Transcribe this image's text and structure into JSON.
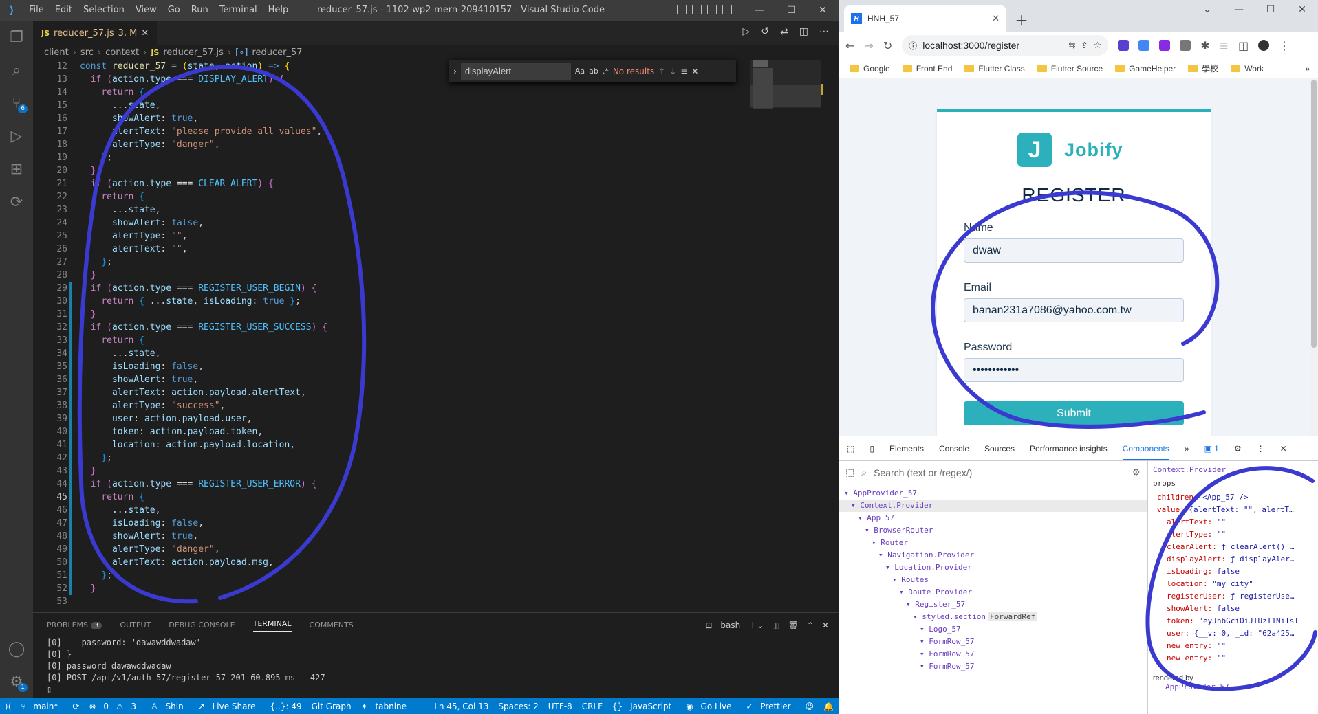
{
  "vscode": {
    "menus": [
      "File",
      "Edit",
      "Selection",
      "View",
      "Go",
      "Run",
      "Terminal",
      "Help"
    ],
    "window_title": "reducer_57.js - 1102-wp2-mern-209410157 - Visual Studio Code",
    "tab": {
      "label": "reducer_57.js",
      "badge": "3, M"
    },
    "breadcrumb": [
      "client",
      "src",
      "context",
      "reducer_57.js",
      "reducer_57"
    ],
    "find": {
      "value": "displayAlert",
      "options": [
        "Aa",
        "ab",
        ".*"
      ],
      "result": "No results"
    },
    "activity_badges": {
      "source_control": "6",
      "accounts": "1"
    },
    "code_lines": [
      {
        "n": "12",
        "html": "<span class='kw2'>const</span> <span class='fn'>reducer_57</span> = <span class='br1'>(</span><span class='var'>state</span>, <span class='var'>action</span><span class='br1'>)</span> <span class='kw2'>=&gt;</span> <span class='br1'>{</span>"
      },
      {
        "n": "13",
        "html": "  <span class='kw'>if</span> <span class='br2'>(</span><span class='var'>action</span>.<span class='var'>type</span> === <span class='cst'>DISPLAY_ALERT</span><span class='br2'>)</span> <span class='br2'>{</span>"
      },
      {
        "n": "14",
        "html": "    <span class='kw'>return</span> <span class='br3'>{</span>"
      },
      {
        "n": "15",
        "html": "      ...<span class='var'>state</span>,"
      },
      {
        "n": "16",
        "html": "      <span class='var'>showAlert</span>: <span class='bool'>true</span>,"
      },
      {
        "n": "17",
        "html": "      <span class='var'>alertText</span>: <span class='str'>\"please provide all values\"</span>,"
      },
      {
        "n": "18",
        "html": "      <span class='var'>alertType</span>: <span class='str'>\"danger\"</span>,"
      },
      {
        "n": "19",
        "html": "    <span class='br3'>}</span>;"
      },
      {
        "n": "20",
        "html": "  <span class='br2'>}</span>"
      },
      {
        "n": "21",
        "html": "  <span class='kw'>if</span> <span class='br2'>(</span><span class='var'>action</span>.<span class='var'>type</span> === <span class='cst'>CLEAR_ALERT</span><span class='br2'>)</span> <span class='br2'>{</span>"
      },
      {
        "n": "22",
        "html": "    <span class='kw'>return</span> <span class='br3'>{</span>"
      },
      {
        "n": "23",
        "html": "      ...<span class='var'>state</span>,"
      },
      {
        "n": "24",
        "html": "      <span class='var'>showAlert</span>: <span class='bool'>false</span>,"
      },
      {
        "n": "25",
        "html": "      <span class='var'>alertType</span>: <span class='str'>\"\"</span>,"
      },
      {
        "n": "26",
        "html": "      <span class='var'>alertText</span>: <span class='str'>\"\"</span>,"
      },
      {
        "n": "27",
        "html": "    <span class='br3'>}</span>;"
      },
      {
        "n": "28",
        "html": "  <span class='br2'>}</span>"
      },
      {
        "n": "29",
        "html": "  <span class='kw'>if</span> <span class='br2'>(</span><span class='var'>action</span>.<span class='var'>type</span> === <span class='cst'>REGISTER_USER_BEGIN</span><span class='br2'>)</span> <span class='br2'>{</span>",
        "mod": true
      },
      {
        "n": "30",
        "html": "    <span class='kw'>return</span> <span class='br3'>{</span> ...<span class='var'>state</span>, <span class='var'>isLoading</span>: <span class='bool'>true</span> <span class='br3'>}</span>;",
        "mod": true
      },
      {
        "n": "31",
        "html": "  <span class='br2'>}</span>",
        "mod": true
      },
      {
        "n": "32",
        "html": "  <span class='kw'>if</span> <span class='br2'>(</span><span class='var'>action</span>.<span class='var'>type</span> === <span class='cst'>REGISTER_USER_SUCCESS</span><span class='br2'>)</span> <span class='br2'>{</span>",
        "mod": true
      },
      {
        "n": "33",
        "html": "    <span class='kw'>return</span> <span class='br3'>{</span>",
        "mod": true
      },
      {
        "n": "34",
        "html": "      ...<span class='var'>state</span>,",
        "mod": true
      },
      {
        "n": "35",
        "html": "      <span class='var'>isLoading</span>: <span class='bool'>false</span>,",
        "mod": true
      },
      {
        "n": "36",
        "html": "      <span class='var'>showAlert</span>: <span class='bool'>true</span>,",
        "mod": true
      },
      {
        "n": "37",
        "html": "      <span class='var'>alertText</span>: <span class='var'>action</span>.<span class='var'>payload</span>.<span class='var'>alertText</span>,",
        "mod": true
      },
      {
        "n": "38",
        "html": "      <span class='var'>alertType</span>: <span class='str'>\"success\"</span>,",
        "mod": true
      },
      {
        "n": "39",
        "html": "      <span class='var'>user</span>: <span class='var'>action</span>.<span class='var'>payload</span>.<span class='var'>user</span>,",
        "mod": true
      },
      {
        "n": "40",
        "html": "      <span class='var'>token</span>: <span class='var'>action</span>.<span class='var'>payload</span>.<span class='var'>token</span>,",
        "mod": true
      },
      {
        "n": "41",
        "html": "      <span class='var'>location</span>: <span class='var'>action</span>.<span class='var'>payload</span>.<span class='var'>location</span>,",
        "mod": true
      },
      {
        "n": "42",
        "html": "    <span class='br3'>}</span>;",
        "mod": true
      },
      {
        "n": "43",
        "html": "  <span class='br2'>}</span>",
        "mod": true
      },
      {
        "n": "44",
        "html": "  <span class='kw'>if</span> <span class='br2'>(</span><span class='var'>action</span>.<span class='var'>type</span> === <span class='cst'>REGISTER_USER_ERROR</span><span class='br2'>)</span> <span class='br2'>{</span>",
        "mod": true
      },
      {
        "n": "45",
        "html": "    <span class='kw'>return</span> <span class='br3'>{</span>",
        "mod": true,
        "active": true
      },
      {
        "n": "46",
        "html": "      ...<span class='var'>state</span>,",
        "mod": true
      },
      {
        "n": "47",
        "html": "      <span class='var'>isLoading</span>: <span class='bool'>false</span>,",
        "mod": true
      },
      {
        "n": "48",
        "html": "      <span class='var'>showAlert</span>: <span class='bool'>true</span>,",
        "mod": true
      },
      {
        "n": "49",
        "html": "      <span class='var'>alertType</span>: <span class='str'>\"danger\"</span>,",
        "mod": true
      },
      {
        "n": "50",
        "html": "      <span class='var'>alertText</span>: <span class='var'>action</span>.<span class='var'>payload</span>.<span class='var'>msg</span>,",
        "mod": true
      },
      {
        "n": "51",
        "html": "    <span class='br3'>}</span>;",
        "mod": true
      },
      {
        "n": "52",
        "html": "  <span class='br2'>}</span>",
        "mod": true
      },
      {
        "n": "53",
        "html": ""
      }
    ],
    "panel": {
      "tabs": [
        "PROBLEMS",
        "OUTPUT",
        "DEBUG CONSOLE",
        "TERMINAL",
        "COMMENTS"
      ],
      "problems_count": "3",
      "active_tab": "TERMINAL",
      "shell": "bash"
    },
    "terminal_lines": [
      "[0]    password: 'dawawddwadaw'",
      "[0] }",
      "[0] password dawawddwadaw",
      "[0] POST /api/v1/auth_57/register_57 201 60.895 ms - 427"
    ],
    "status": {
      "branch": "main*",
      "errors": "0",
      "warnings": "3",
      "user": "Shin",
      "live_share": "Live Share",
      "braces": "{..}: 49",
      "git_graph": "Git Graph",
      "tabnine": "tabnine",
      "position": "Ln 45, Col 13",
      "spaces": "Spaces: 2",
      "encoding": "UTF-8",
      "eol": "CRLF",
      "language": "JavaScript",
      "go_live": "Go Live",
      "prettier": "Prettier"
    }
  },
  "chrome": {
    "tab_title": "HNH_57",
    "url": "localhost:3000/register",
    "bookmarks": [
      "Google",
      "Front End",
      "Flutter Class",
      "Flutter Source",
      "GameHelper",
      "學校",
      "Work"
    ],
    "page": {
      "logo_letter": "J",
      "logo_text": "Jobify",
      "title": "REGISTER",
      "name_label": "Name",
      "name_value": "dwaw",
      "email_label": "Email",
      "email_value": "banan231a7086@yahoo.com.tw",
      "password_label": "Password",
      "password_value": "••••••••••••",
      "submit_label": "Submit"
    },
    "devtools": {
      "tabs": [
        "Elements",
        "Console",
        "Sources",
        "Performance insights",
        "Components"
      ],
      "active_tab": "Components",
      "issues_count": "1",
      "search_placeholder": "Search (text or /regex/)",
      "tree": [
        {
          "label": "AppProvider_57",
          "depth": 0
        },
        {
          "label": "Context.Provider",
          "depth": 1,
          "selected": true
        },
        {
          "label": "App_57",
          "depth": 2
        },
        {
          "label": "BrowserRouter",
          "depth": 3
        },
        {
          "label": "Router",
          "depth": 4
        },
        {
          "label": "Navigation.Provider",
          "depth": 5
        },
        {
          "label": "Location.Provider",
          "depth": 6
        },
        {
          "label": "Routes",
          "depth": 7
        },
        {
          "label": "Route.Provider",
          "depth": 8
        },
        {
          "label": "Register_57",
          "depth": 9
        },
        {
          "label": "styled.section",
          "depth": 10,
          "tag": "ForwardRef"
        },
        {
          "label": "Logo_57",
          "depth": 11
        },
        {
          "label": "FormRow_57",
          "depth": 11
        },
        {
          "label": "FormRow_57",
          "depth": 11
        },
        {
          "label": "FormRow_57",
          "depth": 11
        }
      ],
      "context_name": "Context.Provider",
      "props_header": "props",
      "props": [
        {
          "k": "children",
          "v": "<App_57 />",
          "indent": 0
        },
        {
          "k": "value",
          "v": "{alertText: \"\", alertT…",
          "indent": 0
        },
        {
          "k": "alertText",
          "v": "\"\"",
          "indent": 1
        },
        {
          "k": "alertType",
          "v": "\"\"",
          "indent": 1
        },
        {
          "k": "clearAlert",
          "v": "ƒ clearAlert() …",
          "indent": 1
        },
        {
          "k": "displayAlert",
          "v": "ƒ displayAler…",
          "indent": 1
        },
        {
          "k": "isLoading",
          "v": "false",
          "indent": 1
        },
        {
          "k": "location",
          "v": "\"my city\"",
          "indent": 1
        },
        {
          "k": "registerUser",
          "v": "ƒ registerUse…",
          "indent": 1
        },
        {
          "k": "showAlert",
          "v": "false",
          "indent": 1
        },
        {
          "k": "token",
          "v": "\"eyJhbGciOiJIUzI1NiIsI",
          "indent": 1
        },
        {
          "k": "user",
          "v": "{__v: 0, _id: \"62a425…",
          "indent": 1
        },
        {
          "k": "new entry",
          "v": "\"\"",
          "indent": 1
        },
        {
          "k": "new entry",
          "v": "\"\"",
          "indent": 1
        }
      ],
      "rendered_by_label": "rendered by",
      "rendered_by_value": "AppProvider_57"
    }
  },
  "annotation_color": "#3a3ad0"
}
